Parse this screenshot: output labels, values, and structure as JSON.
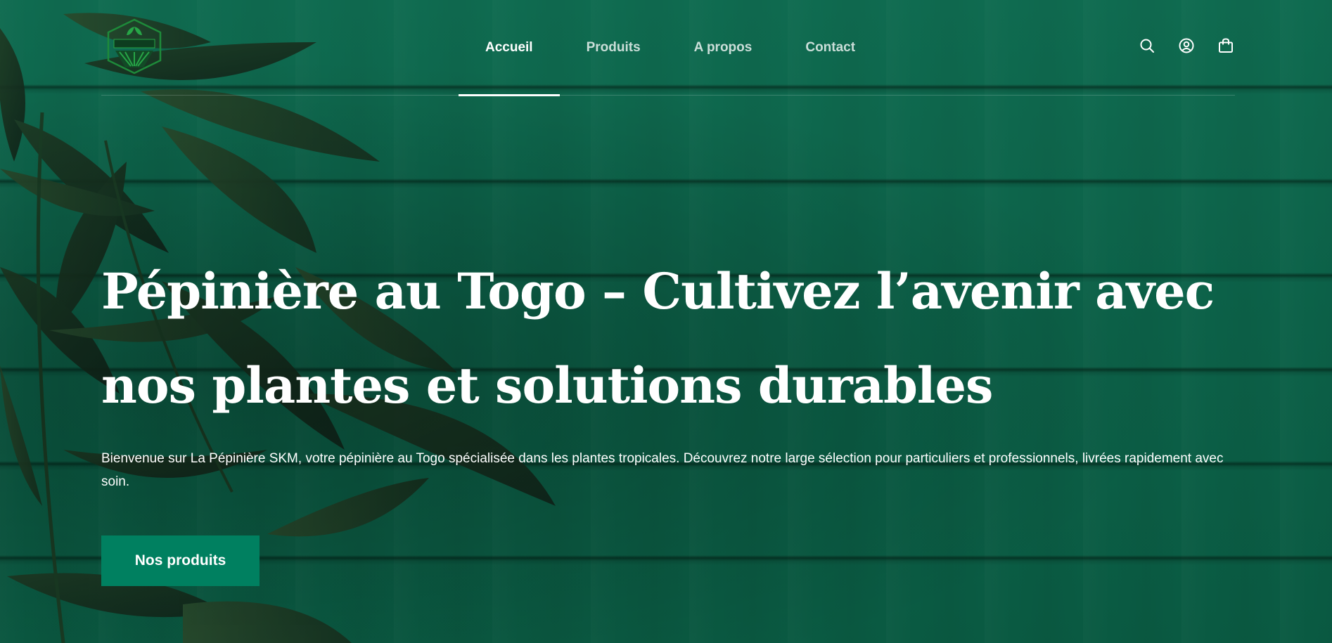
{
  "site": {
    "logo_label": "La Pépinière SKM logo"
  },
  "nav": {
    "items": [
      {
        "label": "Accueil",
        "active": true
      },
      {
        "label": "Produits",
        "active": false
      },
      {
        "label": "A propos",
        "active": false
      },
      {
        "label": "Contact",
        "active": false
      }
    ]
  },
  "header_icons": [
    "search-icon",
    "account-icon",
    "cart-icon"
  ],
  "hero": {
    "title": "Pépinière au Togo – Cultivez l’avenir avec nos plantes et solutions durables",
    "description": "Bienvenue sur La Pépinière SKM, votre pépinière au Togo spécialisée dans les plantes tropicales. Découvrez notre large sélection pour particuliers et professionnels, livrées rapidement avec soin.",
    "cta_label": "Nos produits"
  },
  "colors": {
    "background": "#0b5e46",
    "button": "#008060",
    "text": "#ffffff"
  }
}
